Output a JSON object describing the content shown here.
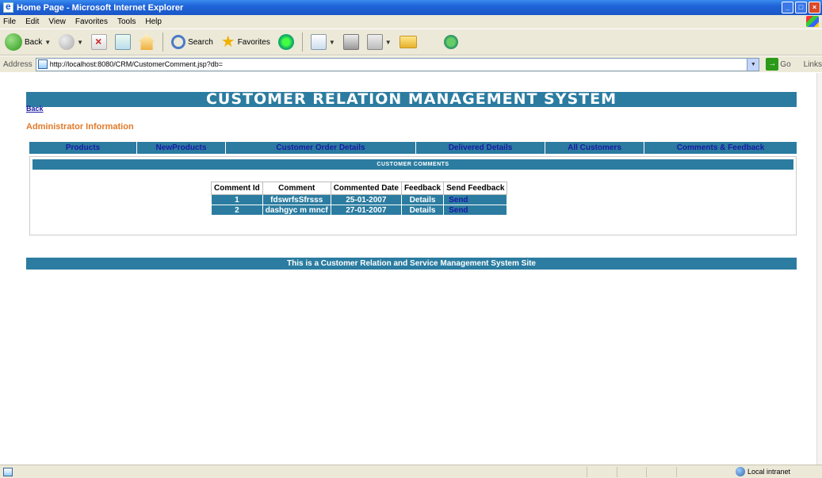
{
  "window": {
    "title": "Home Page - Microsoft Internet Explorer"
  },
  "menu": [
    "File",
    "Edit",
    "View",
    "Favorites",
    "Tools",
    "Help"
  ],
  "toolbar": {
    "back": "Back",
    "search": "Search",
    "favorites": "Favorites"
  },
  "address": {
    "label": "Address",
    "url": "http://localhost:8080/CRM/CustomerComment.jsp?db=",
    "go": "Go",
    "links": "Links"
  },
  "page": {
    "header": "CUSTOMER RELATION MANAGEMENT SYSTEM",
    "back_link": "Back",
    "admin_info": "Administrator Information",
    "nav": [
      {
        "label": "Products"
      },
      {
        "label": "NewProducts"
      },
      {
        "label": "Customer Order Details"
      },
      {
        "label": "Delivered Details"
      },
      {
        "label": "All Customers"
      },
      {
        "label": "Comments & Feedback"
      }
    ],
    "section_title": "CUSTOMER COMMENTS",
    "table": {
      "headers": [
        "Comment Id",
        "Comment",
        "Commented Date",
        "Feedback",
        "Send Feedback"
      ],
      "rows": [
        [
          "1",
          "fdswrfsSfrsss",
          "25-01-2007",
          "Details",
          "Send"
        ],
        [
          "2",
          "dashgyc m mncf",
          "27-01-2007",
          "Details",
          "Send"
        ]
      ]
    },
    "footer": "This is a Customer Relation and Service Management System Site"
  },
  "status": {
    "zone": "Local intranet"
  }
}
